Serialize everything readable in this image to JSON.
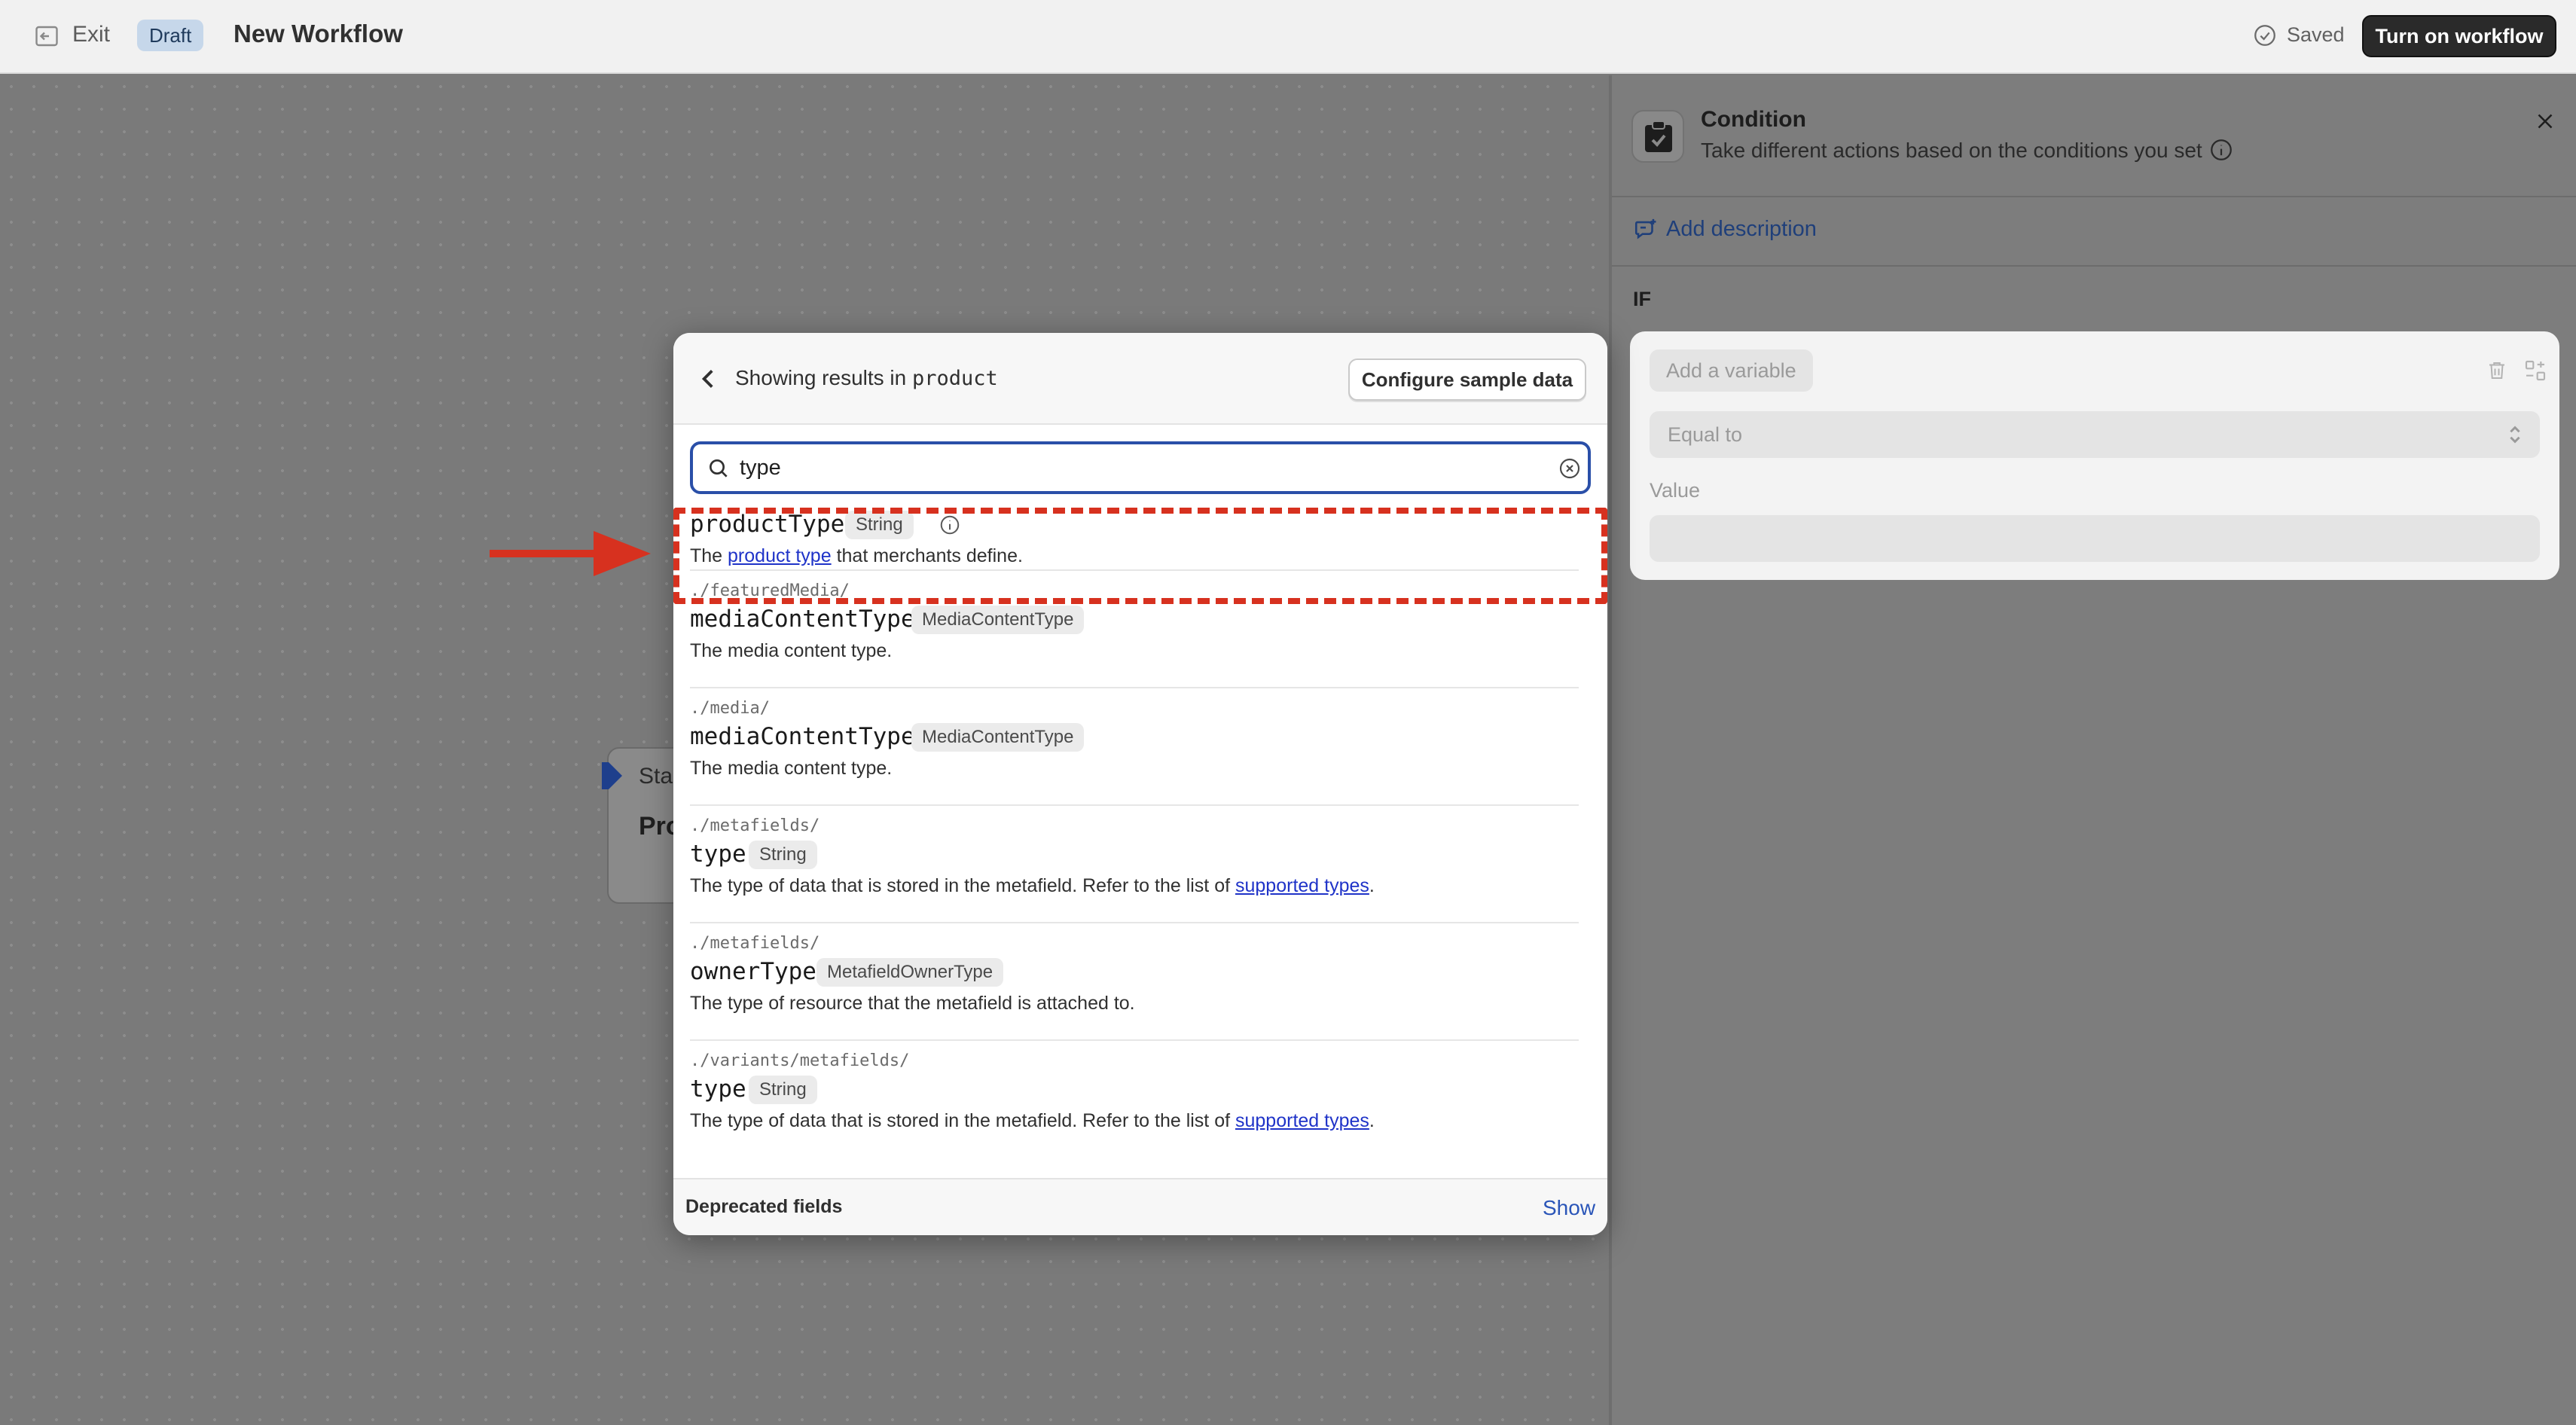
{
  "topbar": {
    "exit_label": "Exit",
    "draft_badge": "Draft",
    "workflow_title": "New Workflow",
    "saved_label": "Saved",
    "turn_on_label": "Turn on workflow"
  },
  "canvas": {
    "start_node": {
      "label": "Sta",
      "title": "Pro"
    }
  },
  "panel": {
    "title": "Condition",
    "description": "Take different actions based on the conditions you set",
    "add_description_label": "Add description",
    "if_label": "IF",
    "condition": {
      "variable_placeholder": "Add a variable",
      "operator_value": "Equal to",
      "value_label": "Value"
    }
  },
  "picker": {
    "showing_prefix": "Showing results in ",
    "scope": "product",
    "configure_label": "Configure sample data",
    "search_value": "type",
    "results": [
      {
        "path": "",
        "name": "productType",
        "type": "String",
        "desc_before": "The ",
        "desc_link": "product type",
        "desc_after": " that merchants define."
      },
      {
        "path": "./featuredMedia/",
        "name": "mediaContentType",
        "type": "MediaContentType",
        "desc_before": "The media content type.",
        "desc_link": "",
        "desc_after": ""
      },
      {
        "path": "./media/",
        "name": "mediaContentType",
        "type": "MediaContentType",
        "desc_before": "The media content type.",
        "desc_link": "",
        "desc_after": ""
      },
      {
        "path": "./metafields/",
        "name": "type",
        "type": "String",
        "desc_before": "The type of data that is stored in the metafield. Refer to the list of ",
        "desc_link": "supported types",
        "desc_after": "."
      },
      {
        "path": "./metafields/",
        "name": "ownerType",
        "type": "MetafieldOwnerType",
        "desc_before": "The type of resource that the metafield is attached to.",
        "desc_link": "",
        "desc_after": ""
      },
      {
        "path": "./variants/metafields/",
        "name": "type",
        "type": "String",
        "desc_before": "The type of data that is stored in the metafield. Refer to the list of ",
        "desc_link": "supported types",
        "desc_after": "."
      }
    ],
    "deprecated_label": "Deprecated fields",
    "show_label": "Show"
  },
  "colors": {
    "accent": "#2a4fa8",
    "link": "#1f33c8",
    "highlight": "#d7311f"
  }
}
